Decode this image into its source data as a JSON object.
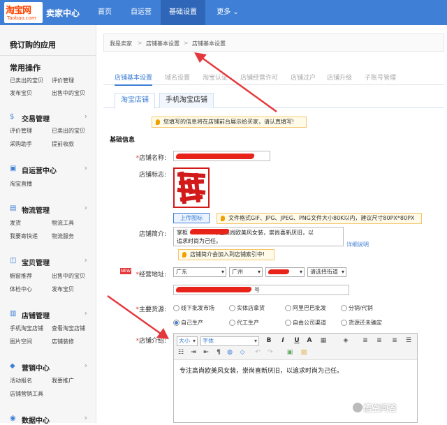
{
  "header": {
    "logo_cn": "淘宝网",
    "logo_en": "Taobao.com",
    "title": "卖家中心",
    "nav": [
      "首页",
      "自运营",
      "基础设置",
      "更多 ⌄"
    ],
    "active_nav": "基础设置"
  },
  "sidebar": {
    "head": "我订购的应用",
    "common": {
      "title": "常用操作",
      "links": [
        "已卖出的宝贝",
        "评价管理",
        "发布宝贝",
        "出售中的宝贝"
      ]
    },
    "trade": {
      "title": "交易管理",
      "links": [
        "评价管理",
        "已卖出的宝贝",
        "采购助手",
        "提前收款"
      ]
    },
    "operate": {
      "title": "自运营中心",
      "links": [
        "淘宝直播"
      ]
    },
    "logistics": {
      "title": "物流管理",
      "links": [
        "发货",
        "物流工具",
        "我要寄快递",
        "物流服务"
      ]
    },
    "goods": {
      "title": "宝贝管理",
      "links": [
        "橱窗推荐",
        "出售中的宝贝",
        "体检中心",
        "发布宝贝"
      ]
    },
    "shop": {
      "title": "店铺管理",
      "links": [
        "手机淘宝店铺",
        "查看淘宝店铺",
        "图片空间",
        "店铺装修"
      ]
    },
    "marketing": {
      "title": "营销中心",
      "links": [
        "活动报名",
        "我要推广",
        "店铺营销工具"
      ]
    },
    "data": {
      "title": "数据中心"
    }
  },
  "breadcrumb": [
    "我是卖家",
    ">",
    "店铺基本设置",
    ">",
    "店铺基本设置"
  ],
  "tabs": [
    "店铺基本设置",
    "域名设置",
    "淘宝认证",
    "店铺经营许可",
    "店铺过户",
    "店铺升级",
    "子账号管理"
  ],
  "subtabs": [
    "淘宝店铺",
    "手机淘宝店铺"
  ],
  "notices": {
    "top": "您填写的信息将在店铺前台展示给买家，请认真填写!",
    "file": "文件格式GIF、JPG、JPEG、PNG文件大小80K以内，建议尺寸80PX*80PX",
    "intro": "店铺简介会加入到店铺索引中!"
  },
  "form": {
    "section": "基础信息",
    "name_label": "店铺名称:",
    "logo_label": "店铺标志:",
    "upload": "上传图标",
    "intro_label": "店铺简介:",
    "intro_value": "掌柜",
    "intro_value2": "专注高尚欧美风女装，崇尚喜新厌旧，以",
    "intro_value3": "追求时尚为己任。",
    "detail_link": "详细说明",
    "addr_label": "经营地址:",
    "new_badge": "NEW",
    "province": "广东",
    "city": "广州",
    "street": "请选择街道",
    "address_tail": "号",
    "source_label": "主要货源:",
    "sources": [
      "线下批发市场",
      "实体店拿货",
      "阿里巴巴批发",
      "分销/代销",
      "自己生产",
      "代工生产",
      "自由公司渠道",
      "货源还未确定"
    ],
    "source_selected": "自己生产",
    "desc_label": "店铺介绍:",
    "font_size": "大小",
    "font_family": "字体",
    "desc_content": "专注高尚欧美风女装，崇尚喜新厌旧，以追求时尚为己任。"
  },
  "watermark": "悟空问答",
  "colors": {
    "accent": "#3f7fd6",
    "annotation": "#e4393c"
  }
}
